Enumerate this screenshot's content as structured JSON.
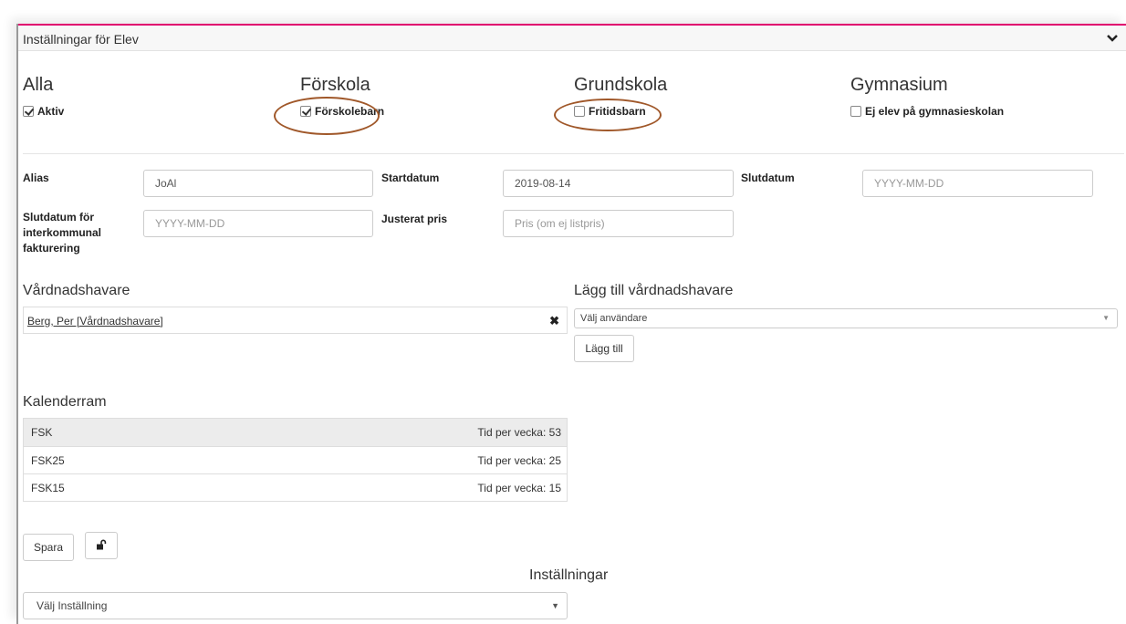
{
  "panel": {
    "title": "Inställningar för Elev"
  },
  "sections": {
    "alla": {
      "title": "Alla",
      "checkbox_label": "Aktiv",
      "checked": true
    },
    "forskola": {
      "title": "Förskola",
      "checkbox_label": "Förskolebarn",
      "checked": true
    },
    "grundskola": {
      "title": "Grundskola",
      "checkbox_label": "Fritidsbarn",
      "checked": false
    },
    "gymnasium": {
      "title": "Gymnasium",
      "checkbox_label": "Ej elev på gymnasieskolan",
      "checked": false
    }
  },
  "fields": {
    "alias": {
      "label": "Alias",
      "value": "JoAl"
    },
    "startdatum": {
      "label": "Startdatum",
      "value": "2019-08-14"
    },
    "slutdatum": {
      "label": "Slutdatum",
      "placeholder": "YYYY-MM-DD"
    },
    "slutdatum_interkommunal": {
      "label": "Slutdatum för interkommunal fakturering",
      "placeholder": "YYYY-MM-DD"
    },
    "justerat_pris": {
      "label": "Justerat pris",
      "placeholder": "Pris (om ej listpris)"
    }
  },
  "guardians": {
    "title": "Vårdnadshavare",
    "items": [
      {
        "name": "Berg, Per [Vårdnadshavare]"
      }
    ],
    "remove_glyph": "✖"
  },
  "add_guardian": {
    "title": "Lägg till vårdnadshavare",
    "select_value": "Välj användare",
    "add_button": "Lägg till"
  },
  "calendar": {
    "title": "Kalenderram",
    "rows": [
      {
        "name": "FSK",
        "hours": "Tid per vecka: 53"
      },
      {
        "name": "FSK25",
        "hours": "Tid per vecka: 25"
      },
      {
        "name": "FSK15",
        "hours": "Tid per vecka: 15"
      }
    ]
  },
  "actions": {
    "save_label": "Spara"
  },
  "settings": {
    "title": "Inställningar",
    "select_value": "Välj Inställning"
  },
  "colors": {
    "accent": "#e0006e",
    "annotation": "#a0582a"
  }
}
